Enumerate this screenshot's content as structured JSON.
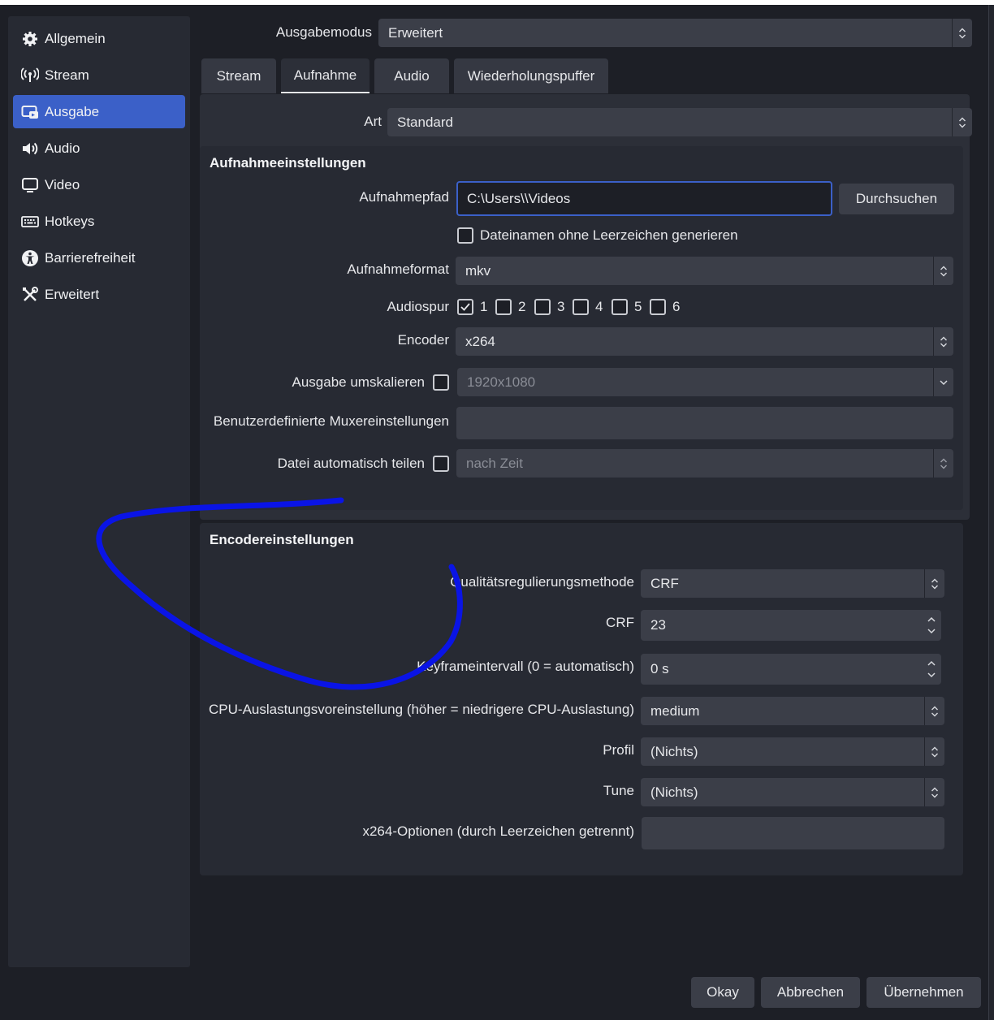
{
  "sidebar": {
    "items": [
      {
        "label": "Allgemein",
        "icon": "gear-icon"
      },
      {
        "label": "Stream",
        "icon": "antenna-icon"
      },
      {
        "label": "Ausgabe",
        "icon": "output-icon",
        "active": true
      },
      {
        "label": "Audio",
        "icon": "speaker-icon"
      },
      {
        "label": "Video",
        "icon": "monitor-icon"
      },
      {
        "label": "Hotkeys",
        "icon": "keyboard-icon"
      },
      {
        "label": "Barrierefreiheit",
        "icon": "accessibility-icon"
      },
      {
        "label": "Erweitert",
        "icon": "tools-icon"
      }
    ]
  },
  "output_mode": {
    "label": "Ausgabemodus",
    "value": "Erweitert"
  },
  "tabs": [
    {
      "label": "Stream"
    },
    {
      "label": "Aufnahme",
      "active": true
    },
    {
      "label": "Audio"
    },
    {
      "label": "Wiederholungspuffer"
    }
  ],
  "type": {
    "label": "Art",
    "value": "Standard"
  },
  "recording": {
    "title": "Aufnahmeeinstellungen",
    "path_label": "Aufnahmepfad",
    "path_value": "C:\\Users\\\\Videos",
    "browse": "Durchsuchen",
    "nospace_label": "Dateinamen ohne Leerzeichen generieren",
    "nospace_checked": false,
    "format_label": "Aufnahmeformat",
    "format_value": "mkv",
    "audiotrack_label": "Audiospur",
    "tracks": [
      {
        "label": "1",
        "checked": true
      },
      {
        "label": "2",
        "checked": false
      },
      {
        "label": "3",
        "checked": false
      },
      {
        "label": "4",
        "checked": false
      },
      {
        "label": "5",
        "checked": false
      },
      {
        "label": "6",
        "checked": false
      }
    ],
    "encoder_label": "Encoder",
    "encoder_value": "x264",
    "rescale_label": "Ausgabe umskalieren",
    "rescale_value": "1920x1080",
    "muxer_label": "Benutzerdefinierte Muxereinstellungen",
    "muxer_value": "",
    "split_label": "Datei automatisch teilen",
    "split_value": "nach Zeit"
  },
  "encoder": {
    "title": "Encodereinstellungen",
    "rc_label": "Qualitätsregulierungsmethode",
    "rc_value": "CRF",
    "crf_label": "CRF",
    "crf_value": "23",
    "keyint_label": "Keyframeintervall (0 = automatisch)",
    "keyint_value": "0 s",
    "preset_label": "CPU-Auslastungsvoreinstellung (höher = niedrigere CPU-Auslastung)",
    "preset_value": "medium",
    "profile_label": "Profil",
    "profile_value": "(Nichts)",
    "tune_label": "Tune",
    "tune_value": "(Nichts)",
    "options_label": "x264-Optionen (durch Leerzeichen getrennt)",
    "options_value": ""
  },
  "footer": {
    "ok": "Okay",
    "cancel": "Abbrechen",
    "apply": "Übernehmen"
  },
  "colors": {
    "accent": "#3b60c8",
    "annotation": "#0a14e6",
    "background": "#1d1f26",
    "panel": "#272a33"
  }
}
